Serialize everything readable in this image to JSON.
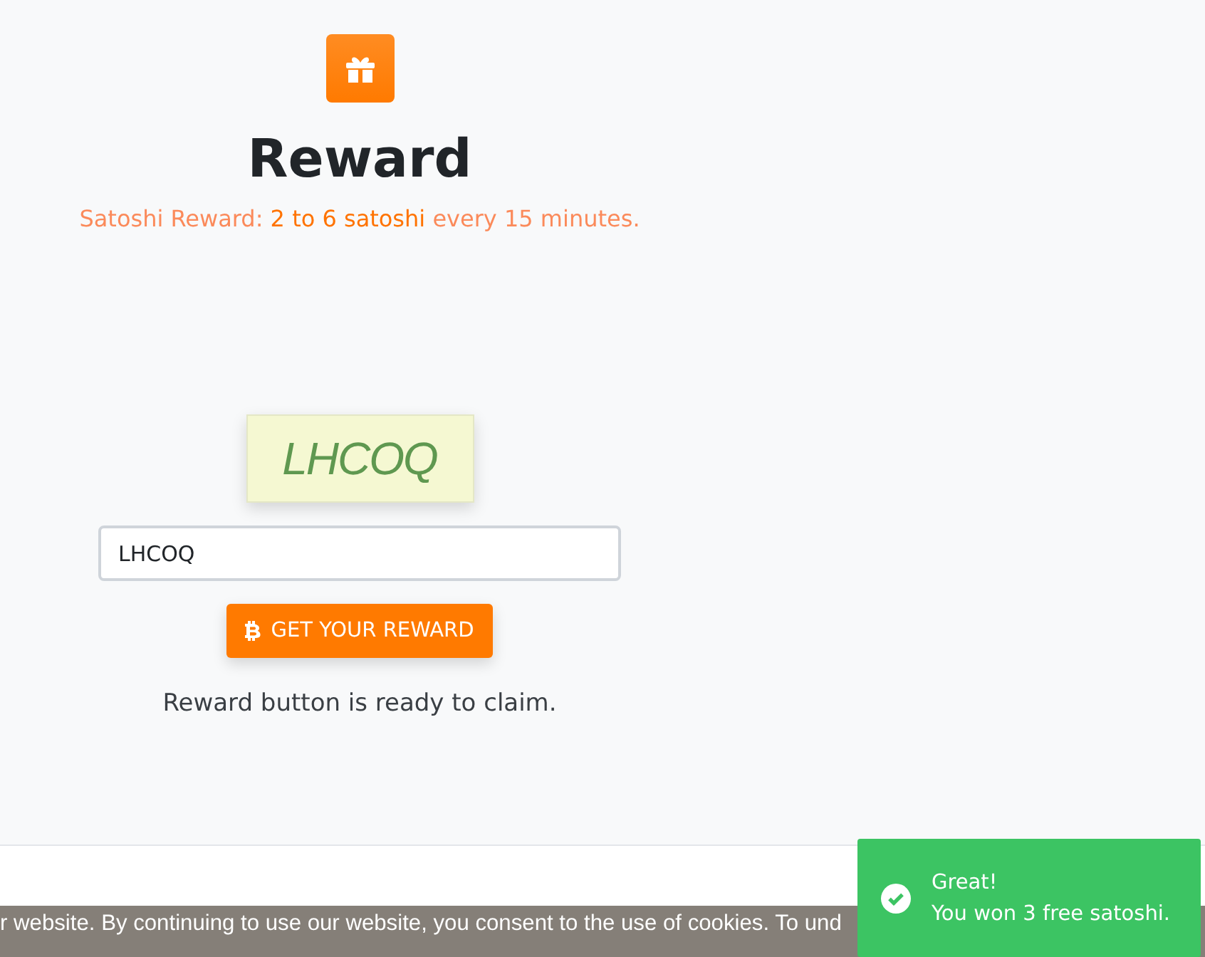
{
  "header": {
    "title": "Reward",
    "subtitle": "Satoshi Reward: **2 to 6 satoshi** every 15 minutes."
  },
  "captcha": {
    "text": "LHCOQ"
  },
  "answer_field": {
    "value": "LHCOQ"
  },
  "reward_button": {
    "label": "GET YOUR REWARD"
  },
  "status": "Reward button is ready to claim.",
  "cookie_bar": {
    "text": "r website. By continuing to use our website, you consent to the use of cookies. To und"
  },
  "toast": {
    "title": "Great!",
    "message": "You won 3 free satoshi."
  }
}
